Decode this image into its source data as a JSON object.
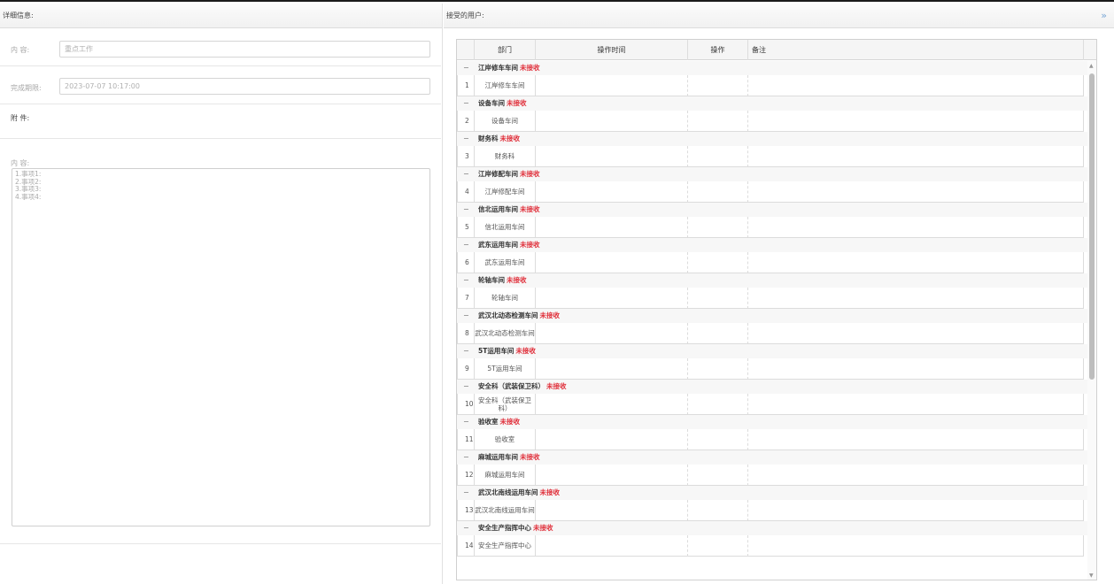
{
  "left_panel": {
    "header": "详细信息:",
    "fields": [
      {
        "label": "内  容:",
        "value": "重点工作"
      },
      {
        "label": "完成期限:",
        "value": "2023-07-07 10:17:00"
      }
    ],
    "attachment_label": "附  件:",
    "content_label": "内  容:",
    "content_text": "1.事项1:\n2.事项2:\n3.事项3:\n4.事项4:"
  },
  "right_panel": {
    "header": "接受的用户:",
    "expand_icon": "»",
    "columns": [
      "部门",
      "操作时间",
      "操作",
      "备注"
    ],
    "groups": [
      {
        "toggle": "−",
        "name": "江岸修车车间",
        "status": "未接收",
        "row_num": "1",
        "dept": "江岸修车车间"
      },
      {
        "toggle": "−",
        "name": "设备车间",
        "status": "未接收",
        "row_num": "2",
        "dept": "设备车间"
      },
      {
        "toggle": "−",
        "name": "财务科",
        "status": "未接收",
        "row_num": "3",
        "dept": "财务科"
      },
      {
        "toggle": "−",
        "name": "江岸修配车间",
        "status": "未接收",
        "row_num": "4",
        "dept": "江岸修配车间"
      },
      {
        "toggle": "−",
        "name": "信北运用车间",
        "status": "未接收",
        "row_num": "5",
        "dept": "信北运用车间"
      },
      {
        "toggle": "−",
        "name": "武东运用车间",
        "status": "未接收",
        "row_num": "6",
        "dept": "武东运用车间"
      },
      {
        "toggle": "−",
        "name": "轮轴车间",
        "status": "未接收",
        "row_num": "7",
        "dept": "轮轴车间"
      },
      {
        "toggle": "−",
        "name": "武汉北动态检测车间",
        "status": "未接收",
        "row_num": "8",
        "dept": "武汉北动态检测车间"
      },
      {
        "toggle": "−",
        "name": "5T运用车间",
        "status": "未接收",
        "row_num": "9",
        "dept": "5T运用车间"
      },
      {
        "toggle": "−",
        "name": "安全科（武装保卫科）",
        "status": "未接收",
        "row_num": "10",
        "dept": "安全科（武装保卫科）"
      },
      {
        "toggle": "−",
        "name": "验收室",
        "status": "未接收",
        "row_num": "11",
        "dept": "验收室"
      },
      {
        "toggle": "−",
        "name": "麻城运用车间",
        "status": "未接收",
        "row_num": "12",
        "dept": "麻城运用车间"
      },
      {
        "toggle": "−",
        "name": "武汉北南线运用车间",
        "status": "未接收",
        "row_num": "13",
        "dept": "武汉北南线运用车间"
      },
      {
        "toggle": "−",
        "name": "安全生产指挥中心",
        "status": "未接收",
        "row_num": "14",
        "dept": "安全生产指挥中心"
      }
    ],
    "scroll_up_icon": "▲",
    "scroll_down_icon": "▼"
  },
  "colors": {
    "status_red": "#e0303b",
    "link_blue": "#7aa7d6"
  }
}
